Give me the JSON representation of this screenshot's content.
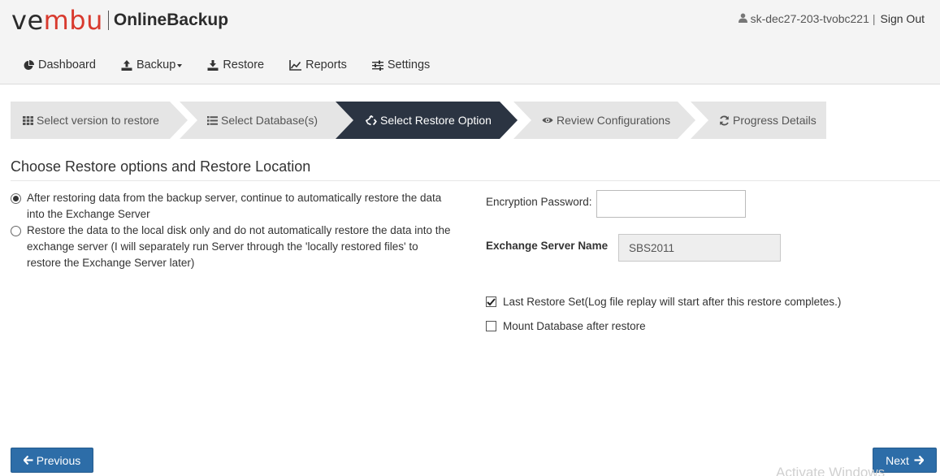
{
  "brand": {
    "logo_part1": "ve",
    "logo_part2": "mbu",
    "product": "OnlineBackup",
    "accent_red": "#d83a2e"
  },
  "user": {
    "icon": "user-icon",
    "name": "sk-dec27-203-tvobc221",
    "separator": "|",
    "signout_label": "Sign Out"
  },
  "nav": {
    "items": [
      {
        "label": "Dashboard",
        "icon": "pie-chart-icon"
      },
      {
        "label": "Backup",
        "icon": "upload-icon",
        "dropdown": true
      },
      {
        "label": "Restore",
        "icon": "download-icon"
      },
      {
        "label": "Reports",
        "icon": "line-chart-icon"
      },
      {
        "label": "Settings",
        "icon": "sliders-icon"
      }
    ]
  },
  "wizard": {
    "steps": [
      {
        "label": "Select version to restore",
        "icon": "grid-icon",
        "state": "done"
      },
      {
        "label": "Select Database(s)",
        "icon": "list-icon",
        "state": "done"
      },
      {
        "label": "Select Restore Option",
        "icon": "recycle-icon",
        "state": "active"
      },
      {
        "label": "Review Configurations",
        "icon": "eye-icon",
        "state": "pending"
      },
      {
        "label": "Progress Details",
        "icon": "refresh-icon",
        "state": "pending"
      }
    ],
    "active_color": "#2b3442",
    "inactive_color": "#e5e5e5"
  },
  "main": {
    "title": "Choose Restore options and Restore Location",
    "restore_options": [
      {
        "line1": "After restoring data from the backup server, continue to automatically restore the data",
        "line2": "into the Exchange Server",
        "line3": "",
        "selected": true
      },
      {
        "line1": "Restore the data to the local disk only and do not automatically restore the data into the",
        "line2": "exchange server (I will separately run Server through the 'locally restored files' to",
        "line3": "restore the Exchange Server later)",
        "selected": false
      }
    ],
    "encryption_label": "Encryption Password:",
    "encryption_value": "",
    "exchange_label": "Exchange Server Name",
    "exchange_value": "SBS2011",
    "last_restore_label": "Last Restore Set(Log file replay will start after this restore completes.)",
    "last_restore_checked": true,
    "mount_label": "Mount Database after restore",
    "mount_checked": false
  },
  "buttons": {
    "previous_label": "Previous",
    "next_label": "Next",
    "button_color": "#2d6da8"
  },
  "watermark": "Activate Windows"
}
